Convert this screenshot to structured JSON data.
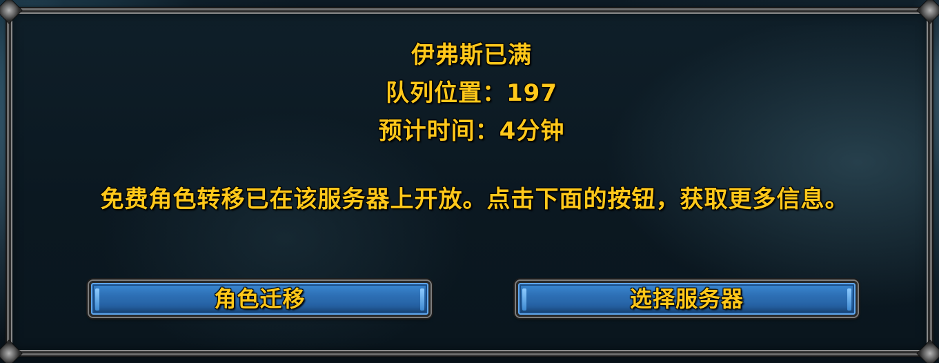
{
  "queue": {
    "realm_full": "伊弗斯已满",
    "position": "队列位置：197",
    "eta": "预计时间：4分钟"
  },
  "notice": {
    "text": "免费角色转移已在该服务器上开放。点击下面的按钮，获取更多信息。"
  },
  "buttons": {
    "character_transfer": "角色迁移",
    "select_server": "选择服务器"
  },
  "colors": {
    "text_gold": "#ffc81a",
    "button_blue": "#2d6fb4",
    "frame_gray": "#6e6e6e"
  }
}
